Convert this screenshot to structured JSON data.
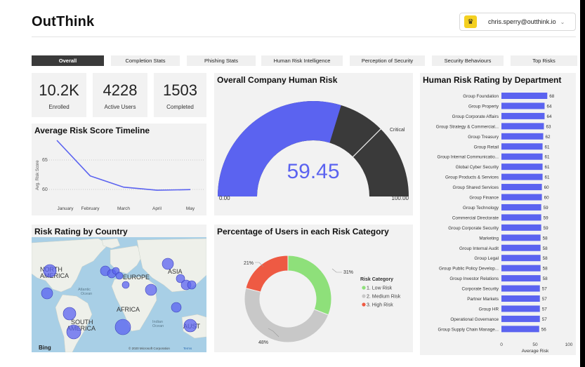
{
  "header": {
    "app_title": "OutThink",
    "user_email": "chris.sperry@outthink.io"
  },
  "tabs": [
    {
      "label": "Overall",
      "active": true
    },
    {
      "label": "Completion Stats",
      "active": false
    },
    {
      "label": "Phishing Stats",
      "active": false
    },
    {
      "label": "Human Risk Intelligence",
      "active": false
    },
    {
      "label": "Perception of Security",
      "active": false
    },
    {
      "label": "Security Behaviours",
      "active": false
    },
    {
      "label": "Top Risks",
      "active": false
    }
  ],
  "kpis": [
    {
      "value": "10.2K",
      "label": "Enrolled"
    },
    {
      "value": "4228",
      "label": "Active Users"
    },
    {
      "value": "1503",
      "label": "Completed"
    }
  ],
  "colors": {
    "accent": "#5b63f0",
    "gauge_bg": "#3a3a3a",
    "card_bg": "#f2f2f2",
    "low": "#8ee07a",
    "medium": "#c8c8c8",
    "high": "#ee5a43"
  },
  "timeline_chart": {
    "title": "Average Risk Score Timeline",
    "chart_data": {
      "type": "line",
      "title": "Average Risk Score Timeline",
      "ylabel": "Avg. Risk Score",
      "categories": [
        "January",
        "February",
        "March",
        "April",
        "May"
      ],
      "values": [
        67.5,
        61.8,
        60.0,
        59.5,
        59.6
      ],
      "ylim": [
        58.5,
        67.5
      ],
      "yticks": [
        "65",
        "60"
      ]
    }
  },
  "gauge_chart": {
    "title": "Overall Company Human Risk",
    "value_text": "59.45",
    "min_label": "0.00",
    "max_label": "100.00",
    "critical_label": "Critical",
    "chart_data": {
      "type": "gauge",
      "value": 59.45,
      "min": 0,
      "max": 100,
      "critical_threshold": 75
    }
  },
  "map_card": {
    "title": "Risk Rating by Country",
    "labels": {
      "north_america": "NORTH AMERICA",
      "europe": "EUROPE",
      "asia": "ASIA",
      "africa": "AFRICA",
      "south_america": "SOUTH AMERICA",
      "atlantic": "Atlantic Ocean",
      "indian": "Indian Ocean",
      "aust": "AUST"
    },
    "bing_label": "Bing",
    "copyright": "© 2020 Microsoft Corporation",
    "terms": "Terms"
  },
  "donut_chart": {
    "title": "Percentage of Users in each Risk Category",
    "legend_title": "Risk Category",
    "chart_data": {
      "type": "pie",
      "categories": [
        "1. Low Risk",
        "2. Medium Risk",
        "3. High Risk"
      ],
      "values": [
        31,
        48,
        21
      ],
      "labels": [
        "31%",
        "48%",
        "21%"
      ]
    }
  },
  "dept_chart": {
    "title": "Human Risk Rating by Department",
    "xlabel": "Average Risk",
    "xticks": [
      "0",
      "50",
      "100"
    ],
    "chart_data": {
      "type": "bar",
      "orientation": "horizontal",
      "xlim": [
        0,
        100
      ],
      "categories": [
        "Group Foundation",
        "Group Property",
        "Group Corporate Affairs",
        "Group Strategy & Commercial...",
        "Group Treasury",
        "Group Retail",
        "Group Internal Communicatio...",
        "Global Cyber Security",
        "Group Products & Services",
        "Group Shared Services",
        "Group Finance",
        "Group Technology",
        "Commercial Directorate",
        "Group Corporate Security",
        "Marketing",
        "Group Internal Audit",
        "Group Legal",
        "Group Public Policy Develop...",
        "Group Investor Relations",
        "Corporate Security",
        "Partner Markets",
        "Group HR",
        "Operational Governance",
        "Group Supply Chain Manage..."
      ],
      "values": [
        68,
        64,
        64,
        63,
        62,
        61,
        61,
        61,
        61,
        60,
        60,
        59,
        59,
        59,
        58,
        58,
        58,
        58,
        58,
        57,
        57,
        57,
        57,
        56
      ]
    }
  }
}
